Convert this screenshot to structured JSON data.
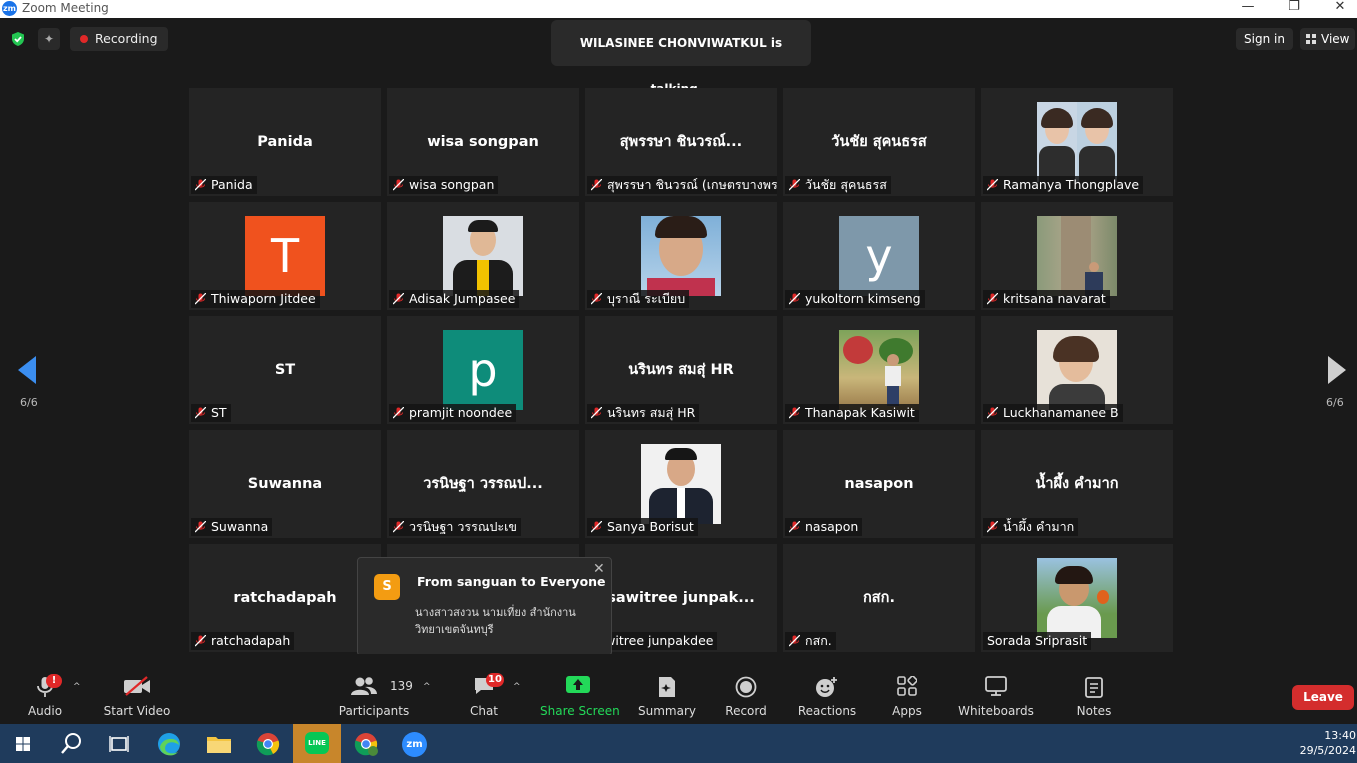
{
  "window": {
    "app_title": "Zoom Meeting",
    "logo_text": "zm",
    "controls": [
      "—",
      "❐",
      "✕"
    ]
  },
  "topbar": {
    "recording_label": "Recording",
    "talking_text": "WILASINEE CHONVIWATKUL is talking...",
    "signin_label": "Sign in",
    "view_label": "View"
  },
  "pager": {
    "left": "6/6",
    "right": "6/6"
  },
  "participants": [
    {
      "center": "Panida",
      "label": "Panida"
    },
    {
      "center": "wisa songpan",
      "label": "wisa songpan"
    },
    {
      "center": "สุพรรษา ชินวรณ์...",
      "label": "สุพรรษา ชินวรณ์ (เกษตรบางพระ)"
    },
    {
      "center": "วันชัย สุคนธรส",
      "label": "วันชัย สุคนธรส"
    },
    {
      "center": "",
      "label": "Ramanya Thongplave"
    },
    {
      "center": "",
      "letter": "T",
      "label": "Thiwaporn Jitdee"
    },
    {
      "center": "",
      "label": "Adisak Jumpasee"
    },
    {
      "center": "",
      "label": "บุราณี ระเบียบ"
    },
    {
      "center": "",
      "letter": "y",
      "label": "yukoltorn kimseng"
    },
    {
      "center": "",
      "label": "kritsana navarat"
    },
    {
      "center": "ST",
      "label": "ST"
    },
    {
      "center": "",
      "letter": "p",
      "label": "pramjit noondee"
    },
    {
      "center": "นรินทร สมสุ่ HR",
      "label": "นรินทร สมสุ่ HR"
    },
    {
      "center": "",
      "label": "Thanapak Kasiwit"
    },
    {
      "center": "",
      "label": "Luckhanamanee B"
    },
    {
      "center": "Suwanna",
      "label": "Suwanna"
    },
    {
      "center": "วรนิษฐา  วรรณป...",
      "label": "วรนิษฐา  วรรณปะเข"
    },
    {
      "center": "",
      "label": "Sanya Borisut"
    },
    {
      "center": "nasapon",
      "label": "nasapon"
    },
    {
      "center": "น้ำผึ้ง  คำมาก",
      "label": "น้ำผึ้ง  คำมาก"
    },
    {
      "center": "ratchadapah",
      "label": "ratchadapah"
    },
    {
      "center": "",
      "label": ""
    },
    {
      "center": "sawitree  junpak...",
      "label": "sawitree junpakdee"
    },
    {
      "center": "กสก.",
      "label": "กสก."
    },
    {
      "center": "",
      "label": "Sorada Sriprasit"
    }
  ],
  "chat_popup": {
    "avatar_letter": "S",
    "from": "From sanguan to Everyone",
    "message": "นางสาวสงวน  นามเที่ยง  สำนักงานวิทยาเขตจันทบุรี"
  },
  "toolbar": {
    "audio": "Audio",
    "audio_badge": "!",
    "start_video": "Start Video",
    "participants": "Participants",
    "participants_count": "139",
    "chat": "Chat",
    "chat_badge": "10",
    "share_screen": "Share Screen",
    "summary": "Summary",
    "record": "Record",
    "reactions": "Reactions",
    "apps": "Apps",
    "whiteboards": "Whiteboards",
    "notes": "Notes",
    "leave": "Leave",
    "caret": "^"
  },
  "taskbar": {
    "time": "13:40",
    "date": "29/5/2024",
    "zoom_label": "zm",
    "line_label": "LINE"
  },
  "colors": {
    "accent_blue": "#3b8ef0",
    "leave_red": "#d42d2d",
    "share_green": "#23d959",
    "muted_red": "#e02828"
  }
}
